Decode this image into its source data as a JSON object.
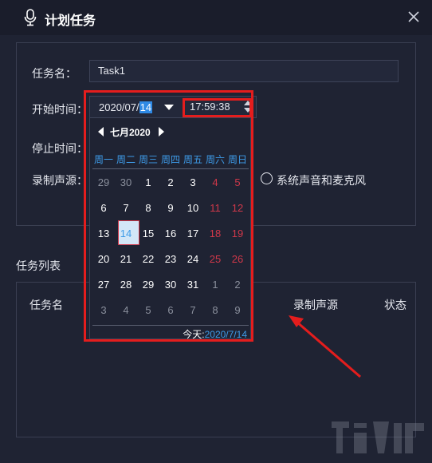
{
  "window": {
    "title": "计划任务"
  },
  "form": {
    "task_name_label": "任务名：",
    "task_name_value": "Task1",
    "start_time_label": "开始时间：",
    "stop_time_label": "停止时间：",
    "record_source_label": "录制声源：",
    "record_source_option": "系统声音和麦克风"
  },
  "picker": {
    "date_prefix": "2020/07/",
    "date_day": "14",
    "time": "17:59:38"
  },
  "calendar": {
    "month_label": "七月2020",
    "weekdays": [
      "周一",
      "周二",
      "周三",
      "周四",
      "周五",
      "周六",
      "周日"
    ],
    "weeks": [
      [
        "29",
        "30",
        "1",
        "2",
        "3",
        "4",
        "5"
      ],
      [
        "6",
        "7",
        "8",
        "9",
        "10",
        "11",
        "12"
      ],
      [
        "13",
        "14",
        "15",
        "16",
        "17",
        "18",
        "19"
      ],
      [
        "20",
        "21",
        "22",
        "23",
        "24",
        "25",
        "26"
      ],
      [
        "27",
        "28",
        "29",
        "30",
        "31",
        "1",
        "2"
      ],
      [
        "3",
        "4",
        "5",
        "6",
        "7",
        "8",
        "9"
      ]
    ],
    "today_label": "今天:",
    "today_value": "2020/7/14"
  },
  "task_list": {
    "title": "任务列表",
    "columns": {
      "name": "任务名",
      "source": "录制声源",
      "status": "状态"
    }
  },
  "colors": {
    "accent": "#3e9be8",
    "highlight_red": "#e41d1d",
    "weekend": "#d0384a",
    "bg": "#1f2333"
  },
  "icons": {
    "title": "microphone-icon",
    "close": "close-icon"
  }
}
